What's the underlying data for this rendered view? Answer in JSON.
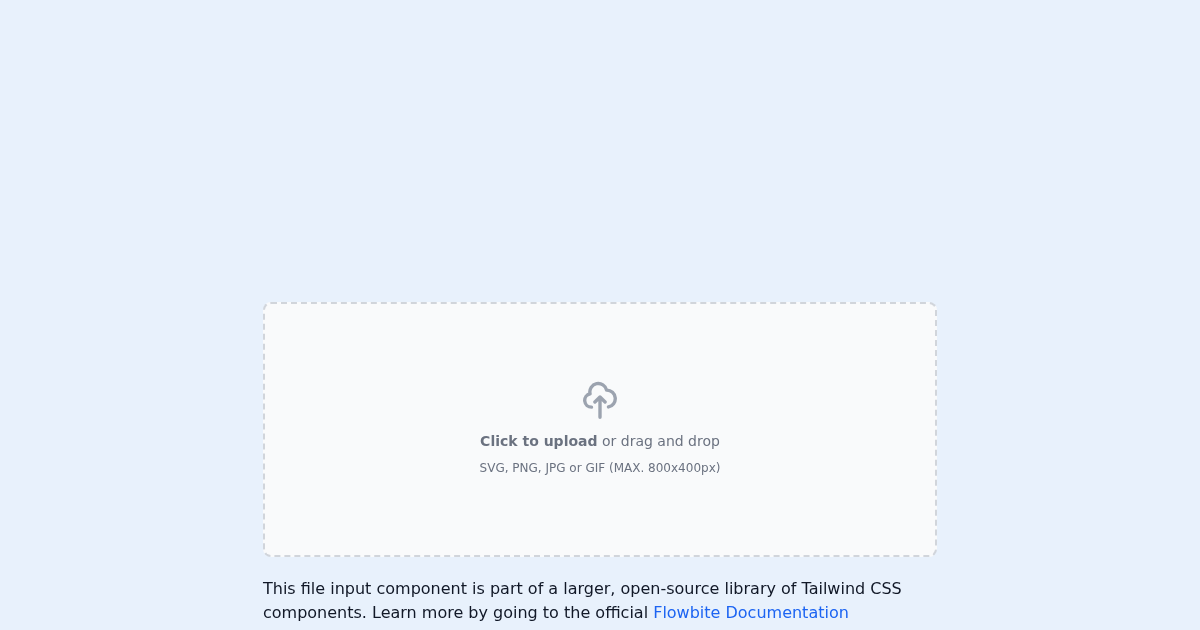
{
  "dropzone": {
    "prompt": "**Click to upload** or drag and drop",
    "hint": "SVG, PNG, JPG or GIF (MAX. 800x400px)"
  },
  "description": {
    "text": "This file input component is part of a larger, open-source library of Tailwind CSS components. Learn more by going to the official ",
    "link": "Flowbite Documentation"
  }
}
